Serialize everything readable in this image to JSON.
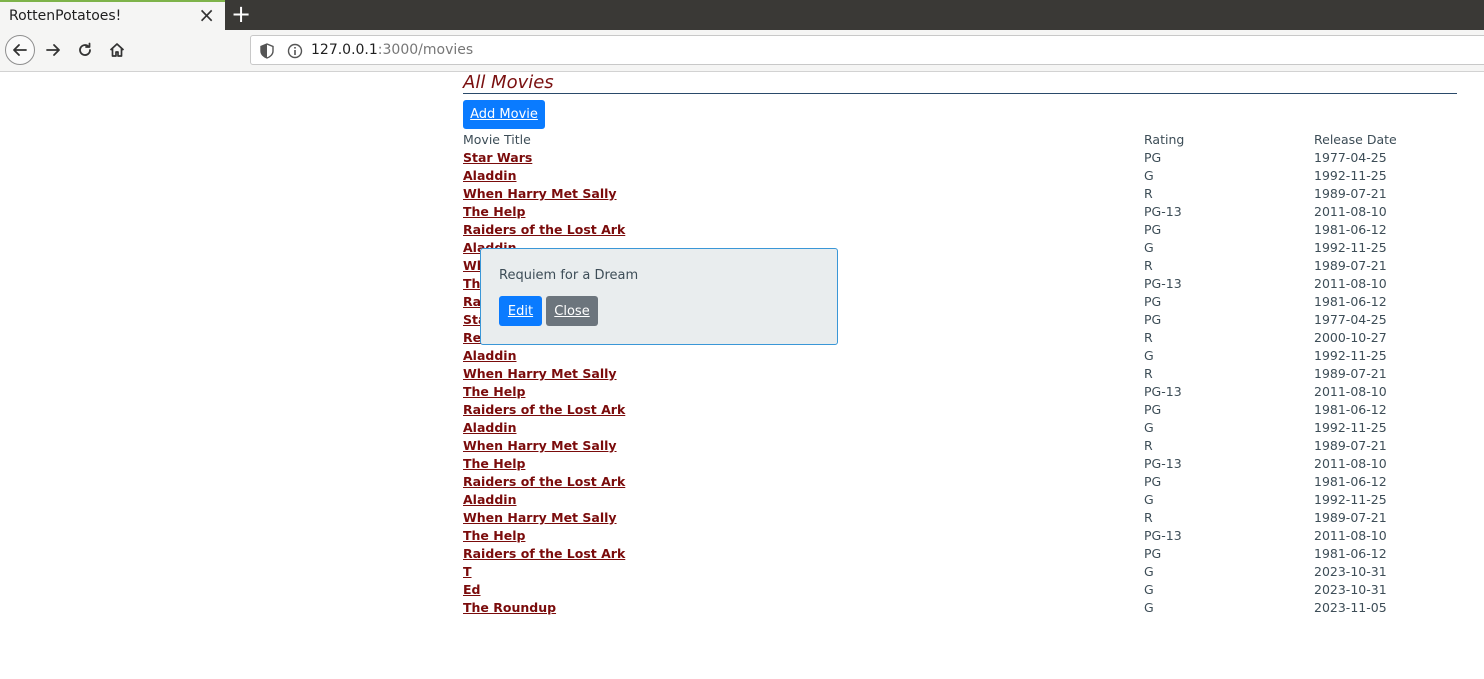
{
  "browser": {
    "tab_title": "RottenPotatoes!",
    "tab_close": "×",
    "new_tab": "+",
    "url_host": "127.0.0.1",
    "url_path": ":3000/movies"
  },
  "page": {
    "title": "All Movies",
    "add_button": "Add Movie"
  },
  "table": {
    "headers": [
      "Movie Title",
      "Rating",
      "Release Date"
    ],
    "rows": [
      {
        "title": "Star Wars",
        "rating": "PG",
        "date": "1977-04-25"
      },
      {
        "title": "Aladdin",
        "rating": "G",
        "date": "1992-11-25"
      },
      {
        "title": "When Harry Met Sally",
        "rating": "R",
        "date": "1989-07-21"
      },
      {
        "title": "The Help",
        "rating": "PG-13",
        "date": "2011-08-10"
      },
      {
        "title": "Raiders of the Lost Ark",
        "rating": "PG",
        "date": "1981-06-12"
      },
      {
        "title": "Aladdin",
        "rating": "G",
        "date": "1992-11-25"
      },
      {
        "title": "When Harry Met Sally",
        "rating": "R",
        "date": "1989-07-21"
      },
      {
        "title": "The Help",
        "rating": "PG-13",
        "date": "2011-08-10"
      },
      {
        "title": "Raiders of the Lost Ark",
        "rating": "PG",
        "date": "1981-06-12"
      },
      {
        "title": "Star Wars",
        "rating": "PG",
        "date": "1977-04-25"
      },
      {
        "title": "Requiem for a Dream",
        "rating": "R",
        "date": "2000-10-27"
      },
      {
        "title": "Aladdin",
        "rating": "G",
        "date": "1992-11-25"
      },
      {
        "title": "When Harry Met Sally",
        "rating": "R",
        "date": "1989-07-21"
      },
      {
        "title": "The Help",
        "rating": "PG-13",
        "date": "2011-08-10"
      },
      {
        "title": "Raiders of the Lost Ark",
        "rating": "PG",
        "date": "1981-06-12"
      },
      {
        "title": "Aladdin",
        "rating": "G",
        "date": "1992-11-25"
      },
      {
        "title": "When Harry Met Sally",
        "rating": "R",
        "date": "1989-07-21"
      },
      {
        "title": "The Help",
        "rating": "PG-13",
        "date": "2011-08-10"
      },
      {
        "title": "Raiders of the Lost Ark",
        "rating": "PG",
        "date": "1981-06-12"
      },
      {
        "title": "Aladdin",
        "rating": "G",
        "date": "1992-11-25"
      },
      {
        "title": "When Harry Met Sally",
        "rating": "R",
        "date": "1989-07-21"
      },
      {
        "title": "The Help",
        "rating": "PG-13",
        "date": "2011-08-10"
      },
      {
        "title": "Raiders of the Lost Ark",
        "rating": "PG",
        "date": "1981-06-12"
      },
      {
        "title": "T",
        "rating": "G",
        "date": "2023-10-31"
      },
      {
        "title": "Ed",
        "rating": "G",
        "date": "2023-10-31"
      },
      {
        "title": "The Roundup",
        "rating": "G",
        "date": "2023-11-05"
      }
    ]
  },
  "popup": {
    "title": "Requiem for a Dream",
    "edit_button": "Edit",
    "close_button": "Close"
  },
  "colors": {
    "link": "#7a0b0b",
    "primary_button": "#0a7bff",
    "secondary_button": "#6c757d",
    "popup_background": "#e9edee",
    "popup_border": "#3a97d7"
  }
}
